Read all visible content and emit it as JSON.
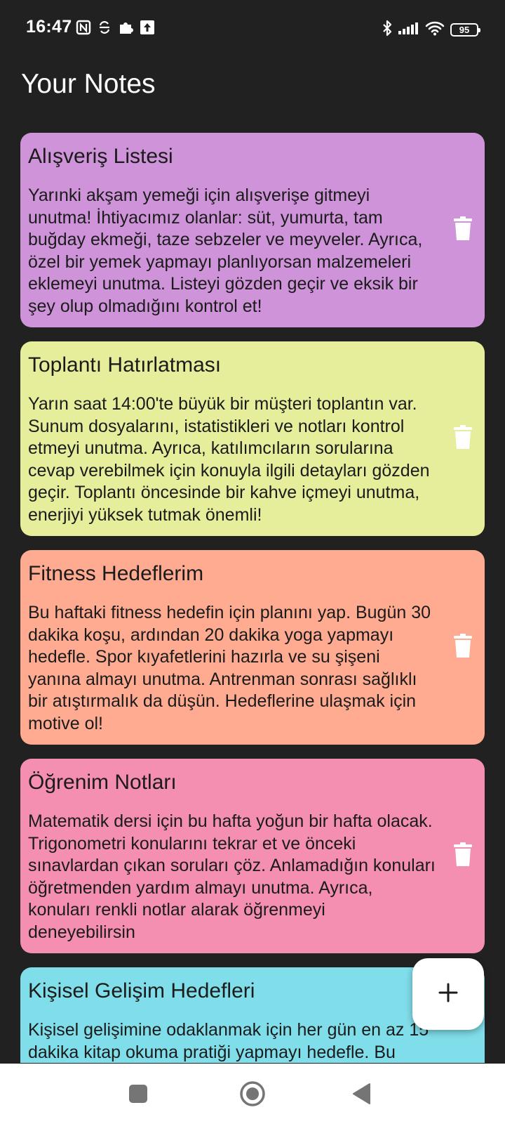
{
  "status_bar": {
    "time": "16:47",
    "battery_level": "95",
    "left_icons": [
      "nfc-icon",
      "sync-icon",
      "puzzle-icon",
      "upload-icon"
    ],
    "right_icons": [
      "bluetooth-icon",
      "signal-icon",
      "wifi-icon",
      "battery-icon"
    ]
  },
  "header": {
    "title": "Your Notes"
  },
  "notes": [
    {
      "title": "Alışveriş Listesi",
      "body": "Yarınki akşam yemeği için alışverişe gitmeyi unutma! İhtiyacımız olanlar: süt, yumurta, tam buğday ekmeği, taze sebzeler ve meyveler. Ayrıca, özel bir yemek yapmayı planlıyorsan malzemeleri eklemeyi unutma. Listeyi gözden geçir ve eksik bir şey olup olmadığını kontrol et!",
      "color": "#CE93D8"
    },
    {
      "title": "Toplantı Hatırlatması",
      "body": "Yarın saat 14:00'te büyük bir müşteri toplantın var. Sunum dosyalarını, istatistikleri ve notları kontrol etmeyi unutma. Ayrıca, katılımcıların sorularına cevap verebilmek için konuyla ilgili detayları gözden geçir. Toplantı öncesinde bir kahve içmeyi unutma, enerjiyi yüksek tutmak önemli!",
      "color": "#E6EE9C"
    },
    {
      "title": "Fitness Hedeflerim",
      "body": "Bu haftaki fitness hedefin için planını yap. Bugün 30 dakika koşu, ardından 20 dakika yoga yapmayı hedefle. Spor kıyafetlerini hazırla ve su şişeni yanına almayı unutma. Antrenman sonrası sağlıklı bir atıştırmalık da düşün. Hedeflerine ulaşmak için motive ol!",
      "color": "#FFAB91"
    },
    {
      "title": "Öğrenim Notları",
      "body": "Matematik dersi için bu hafta yoğun bir hafta olacak. Trigonometri konularını tekrar et ve önceki sınavlardan çıkan soruları çöz. Anlamadığın konuları öğretmenden yardım almayı unutma. Ayrıca, konuları renkli notlar alarak öğrenmeyi deneyebilirsin",
      "color": "#F48FB1"
    },
    {
      "title": "Kişisel Gelişim Hedefleri",
      "body": "Kişisel gelişimine odaklanmak için her gün en az 15 dakika kitap okuma pratiği yapmayı hedefle. Bu",
      "color": "#80DEEA"
    }
  ],
  "fab": {
    "label": "+"
  },
  "nav_bar": {
    "buttons": [
      "recents-square-icon",
      "home-circle-icon",
      "back-triangle-icon"
    ]
  }
}
